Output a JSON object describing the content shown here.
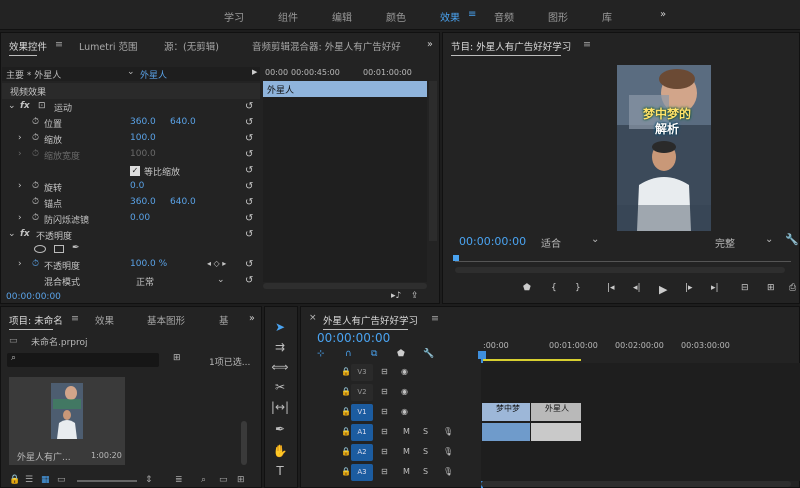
{
  "workspace_tabs": [
    "学习",
    "组件",
    "编辑",
    "颜色",
    "效果",
    "音频",
    "图形",
    "库"
  ],
  "workspace_active": "效果",
  "workspace_more": "»",
  "effect_controls": {
    "tab_label": "效果控件",
    "tab2": "Lumetri 范围",
    "tab3": "源：(无剪辑)",
    "tab4": "音频剪辑混合器: 外星人有广告好好",
    "more": "»",
    "master": "主要 * 外星人",
    "clip_name": "外星人",
    "timecode_ruler": [
      "00:00",
      "00:00:45:00",
      "00:01:00:00"
    ],
    "clip_bar": "外星人",
    "section_video": "视频效果",
    "motion": "运动",
    "position_label": "位置",
    "position_x": "360.0",
    "position_y": "640.0",
    "scale_label": "缩放",
    "scale_val": "100.0",
    "scale_width_label": "缩放宽度",
    "scale_width_val": "100.0",
    "uniform_scale": "等比缩放",
    "rotation_label": "旋转",
    "rotation_val": "0.0",
    "anchor_label": "锚点",
    "anchor_x": "360.0",
    "anchor_y": "640.0",
    "flicker_label": "防闪烁滤镜",
    "flicker_val": "0.00",
    "opacity_section": "不透明度",
    "opacity_label": "不透明度",
    "opacity_val": "100.0 %",
    "blend_label": "混合模式",
    "blend_val": "正常",
    "timecode": "00:00:00:00"
  },
  "program": {
    "title": "节目: 外星人有广告好好学习",
    "timecode": "00:00:00:00",
    "fit": "适合",
    "quality": "完整",
    "overlay_line1": "梦中梦的",
    "overlay_line2": "解析"
  },
  "project": {
    "tab": "项目: 未命名",
    "tab2": "效果",
    "tab3": "基本图形",
    "tab4": "基",
    "more": "»",
    "file": "未命名.prproj",
    "count": "1项已选...",
    "search_placeholder": "",
    "item_name": "外星人有广...",
    "item_dur": "1:00:20"
  },
  "timeline": {
    "title": "外星人有广告好好学习",
    "timecode": "00:00:00:00",
    "ruler": [
      ":00:00",
      "00:01:00:00",
      "00:02:00:00",
      "00:03:00:00"
    ],
    "video_tracks": [
      "V3",
      "V2",
      "V1"
    ],
    "audio_tracks": [
      "A1",
      "A2",
      "A3"
    ],
    "v1_clip1": "梦中梦",
    "v1_clip2": "外星人",
    "mute": "M",
    "solo": "S"
  },
  "colors": {
    "accent": "#4aa3f0",
    "playhead": "#3f8fdc"
  }
}
